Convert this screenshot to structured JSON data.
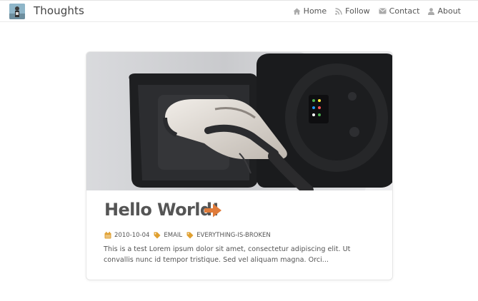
{
  "header": {
    "brand": "Thoughts",
    "nav": [
      {
        "label": "Home",
        "icon": "home-icon"
      },
      {
        "label": "Follow",
        "icon": "rss-icon"
      },
      {
        "label": "Contact",
        "icon": "envelope-icon"
      },
      {
        "label": "About",
        "icon": "user-icon"
      }
    ]
  },
  "post": {
    "title": "Hello World!",
    "date": "2010-10-04",
    "tags": [
      "EMAIL",
      "EVERYTHING-IS-BROKEN"
    ],
    "excerpt": "This is a test Lorem ipsum dolor sit amet, consectetur adipiscing elit. Ut convallis nunc id tempor tristique. Sed vel aliquam magna. Orci..."
  },
  "colors": {
    "accent_orange": "#e07b3a",
    "tag_gold": "#e0a030",
    "text": "#555555"
  }
}
